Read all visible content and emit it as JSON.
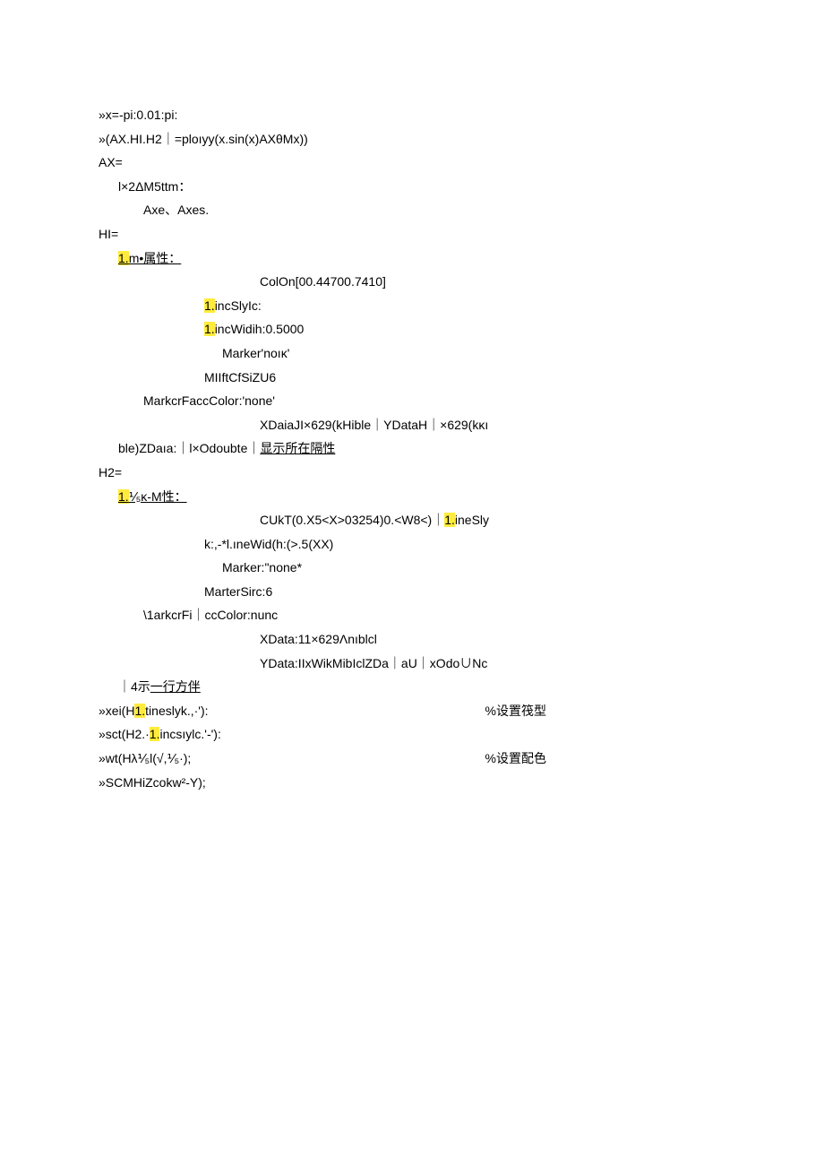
{
  "l1": "»x=-pi:0.01:pi:",
  "l2a": "»(AX.HI.H2",
  "l2b": "｜",
  "l2c": "=ploıyy(x.sin(x)AXθMx))",
  "l3": "AX=",
  "l4": "l×2ΔM5ttm：",
  "l5": "Axe、Axes.",
  "l6": "HI=",
  "l7hl": "1.",
  "l7txt": "m•属性：",
  "l8": "ColOn[00.44700.7410]",
  "l9hl": "1.",
  "l9txt": "incSlyIc:",
  "l10hl": "1.",
  "l10txt": "incWidih:0.5000",
  "l11": "Marker'noıκ'",
  "l12": "MIIftCfSiZU6",
  "l13": "MarkcrFaccColor:'none'",
  "l14": "XDaiaJI×629(kHible｜YDataH｜×629(kκı",
  "l15": "ble)ZDaıa:｜l×Odoubte｜",
  "l15u": "显示所在隔性",
  "l16": "H2=",
  "l17hl": "1.",
  "l17txt": "⅟₅κ-M性：",
  "l18a": "CUkT(0.X5<X>03254)0.<W8<)｜",
  "l18hl": "1.",
  "l18b": "ineSly",
  "l19": "k:,-*l.ıneWid(h:(>.5(XX)",
  "l20": "Marker:\"none*",
  "l21": "MarterSirc:6",
  "l22": "\\1arkcrFi｜ccColor:nunc",
  "l23": "XData:11×629Λnıblcl",
  "l24": "YData:IIxWikMibIclZDa｜aU｜xOdo∪Nc",
  "l25a": "｜4示",
  "l25u": "一行方伴",
  "l26a": "»xei(H",
  "l26hl": "1.",
  "l26b": "tineslyk.,·'):",
  "l26r": "%设置筏型",
  "l27a": "»sct(H2.·",
  "l27hl": "1.",
  "l27b": "incsıylc.'-'):",
  "l28": "»wt(Hλ⅟₅l(√,⅟₅·);",
  "l28r": "%设置配色",
  "l29": "»SCMHiZcokw²-Y);"
}
